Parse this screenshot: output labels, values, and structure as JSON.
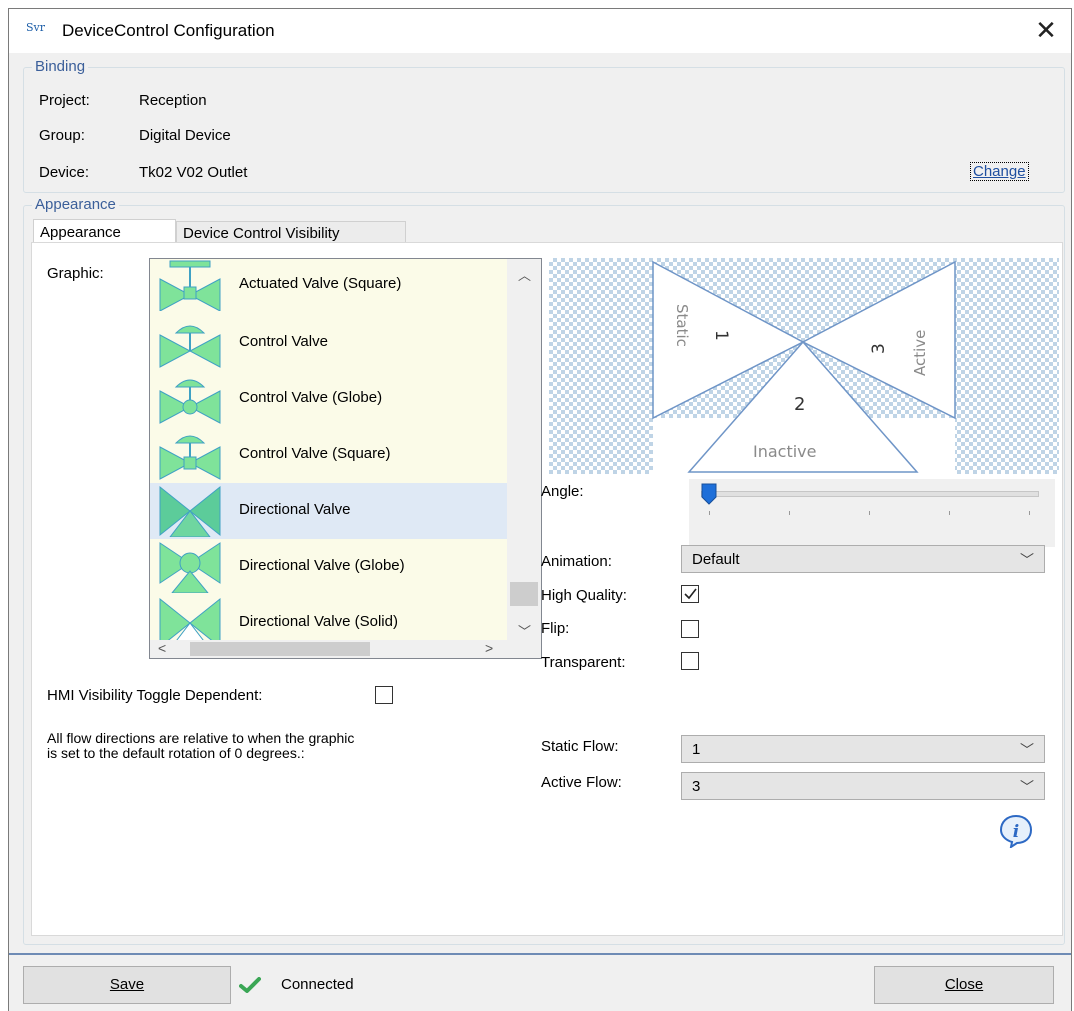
{
  "window": {
    "title": "DeviceControl Configuration",
    "app_icon_text": "Svr",
    "close_glyph": "✕"
  },
  "binding": {
    "legend": "Binding",
    "project_label": "Project:",
    "project_value": "Reception",
    "group_label": "Group:",
    "group_value": "Digital Device",
    "device_label": "Device:",
    "device_value": "Tk02 V02 Outlet",
    "change_link": "Change"
  },
  "appearance": {
    "legend": "Appearance",
    "tabs": [
      {
        "label": "Appearance",
        "active": true
      },
      {
        "label": "Device Control Visibility",
        "active": false
      }
    ],
    "graphic_label": "Graphic:",
    "graphics": [
      {
        "label": "Actuated Valve (Square)",
        "icon": "actuated-valve-square"
      },
      {
        "label": "Control Valve",
        "icon": "control-valve"
      },
      {
        "label": "Control Valve (Globe)",
        "icon": "control-valve-globe"
      },
      {
        "label": "Control Valve (Square)",
        "icon": "control-valve-square"
      },
      {
        "label": "Directional Valve",
        "icon": "directional-valve",
        "selected": true
      },
      {
        "label": "Directional Valve (Globe)",
        "icon": "directional-valve-globe"
      },
      {
        "label": "Directional Valve (Solid)",
        "icon": "directional-valve-solid"
      }
    ],
    "preview": {
      "static_label": "Static",
      "active_label": "Active",
      "inactive_label": "Inactive",
      "port1": "1",
      "port2": "2",
      "port3": "3"
    },
    "angle_label": "Angle:",
    "angle_value_fraction": 0.0,
    "animation_label": "Animation:",
    "animation_value": "Default",
    "high_quality_label": "High Quality:",
    "high_quality": true,
    "flip_label": "Flip:",
    "flip": false,
    "transparent_label": "Transparent:",
    "transparent": false,
    "hmi_toggle_label": "HMI Visibility Toggle Dependent:",
    "hmi_toggle": false,
    "flow_note_line1": "All flow directions are relative to when the graphic",
    "flow_note_line2": "is set to the default rotation of 0 degrees.:",
    "static_flow_label": "Static Flow:",
    "static_flow_value": "1",
    "active_flow_label": "Active Flow:",
    "active_flow_value": "3",
    "info_icon": "info-icon"
  },
  "footer": {
    "save_label": "Save",
    "status_text": "Connected",
    "close_label": "Close"
  },
  "colors": {
    "valve_fill": "#7fe39a",
    "valve_stroke": "#3fa1c4",
    "selection": "#dfe9f5",
    "link": "#1f4fa0",
    "accent_blue": "#1e6fd9"
  }
}
